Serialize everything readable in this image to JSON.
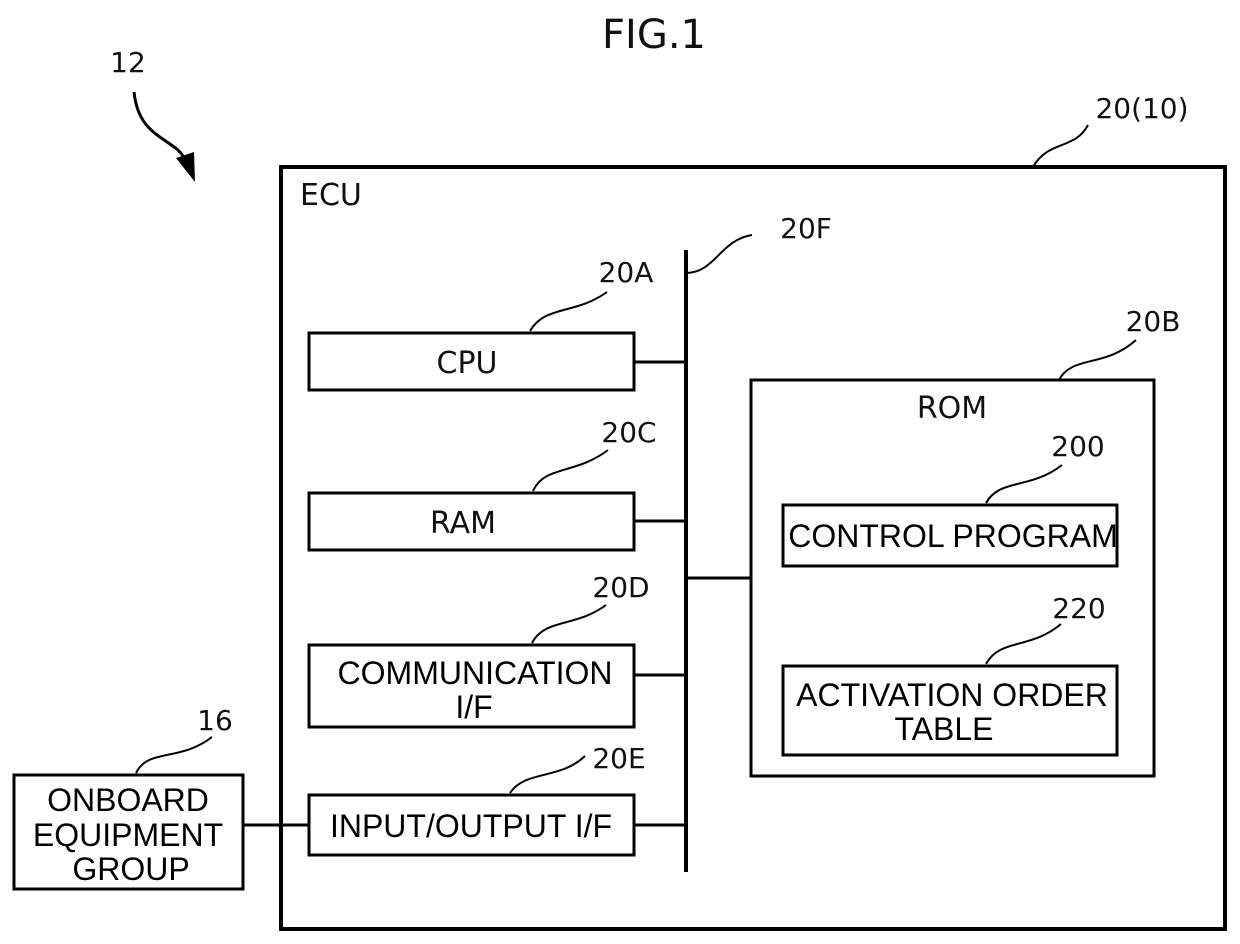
{
  "figure": {
    "title": "FIG.1",
    "system_ref": "12"
  },
  "ecu": {
    "label": "ECU",
    "ref": "20(10)"
  },
  "bus": {
    "ref": "20F"
  },
  "cpu": {
    "label": "CPU",
    "ref": "20A"
  },
  "ram": {
    "label": "RAM",
    "ref": "20C"
  },
  "comm_if": {
    "label_line1": "COMMUNICATION",
    "label_line2": "I/F",
    "ref": "20D"
  },
  "io_if": {
    "label": "INPUT/OUTPUT I/F",
    "ref": "20E"
  },
  "rom": {
    "label": "ROM",
    "ref": "20B",
    "control_program": {
      "label": "CONTROL PROGRAM",
      "ref": "200"
    },
    "activation_table": {
      "label_line1": "ACTIVATION ORDER",
      "label_line2": "TABLE",
      "ref": "220"
    }
  },
  "onboard_equipment": {
    "label_line1": "ONBOARD",
    "label_line2": "EQUIPMENT",
    "label_line3": "GROUP",
    "ref": "16"
  }
}
